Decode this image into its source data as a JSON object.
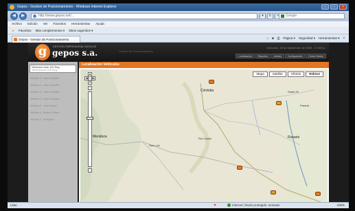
{
  "window": {
    "title": "Gepos - Gestion de Posicionamiento - Windows Internet Explorer"
  },
  "address": {
    "url": "http://www.gepos.net/...",
    "search_placeholder": "Google"
  },
  "menu": [
    "Archivo",
    "Edición",
    "Ver",
    "Favoritos",
    "Herramientas",
    "Ayuda"
  ],
  "favorites": {
    "label": "Favoritos",
    "items": [
      "Más complementos ▾",
      "Sitios sugeridos ▾"
    ]
  },
  "tab": {
    "label": "Gepos - Gestion de Posicionamiento"
  },
  "commands": [
    "Página ▾",
    "Seguridad ▾",
    "Herramientas ▾"
  ],
  "site": {
    "logo_letter": "g",
    "logo_text": "gepos s.a.",
    "tagline": "GESTION EMPRESARIAL MOVILES",
    "subtitle": "Gestion de Posicionamiento",
    "date": "miércoles, 30 de septiembre de 2009 - 17:38 hs",
    "nav": [
      "Localización",
      "Reportes",
      "Alertas",
      "Configuración",
      "Cerrar Sesión"
    ]
  },
  "sidebar": {
    "select_label": "Vehiculos visto 100 Reg.",
    "select_sub": "Vehiculos de 100 Reg.",
    "vehicles": [
      "Vehiculo 1 - Juan Gonzalez",
      "Vehiculo 2 - Jose Gonzalez",
      "Vehiculo 3 - Juan Gonzalez",
      "Vehiculo 4 - Juan Gonzalez",
      "Vehiculo 5 - Juan Gomez",
      "Vehiculo 6 - Andres Gomez",
      "Vehiculo 7 - Rodriguez"
    ]
  },
  "map": {
    "title": "Localización Vehiculos",
    "types": [
      "Mapa",
      "Satélite",
      "Híbrido",
      "Relieve"
    ],
    "active_type": "Relieve",
    "cities": [
      "Córdoba",
      "Santa Fe",
      "Rosario",
      "San Luis",
      "Rio Cuarto",
      "Paraná",
      "Mendoza"
    ]
  },
  "status": {
    "left": "Listo",
    "zone": "Internet | Modo protegido: activado",
    "zoom": "100%"
  }
}
